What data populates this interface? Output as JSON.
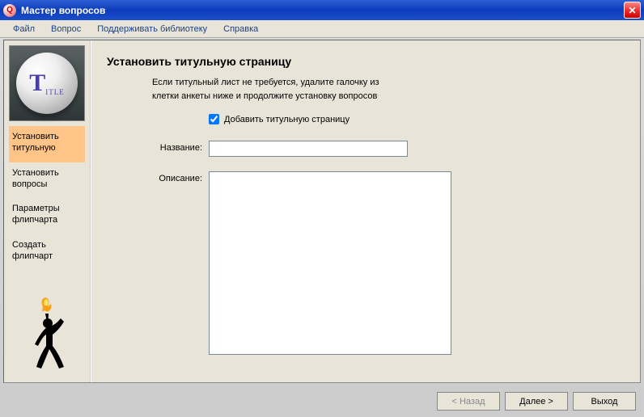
{
  "window": {
    "title": "Мастер вопросов"
  },
  "menu": {
    "file": "Файл",
    "question": "Вопрос",
    "maintain_library": "Поддерживать библиотеку",
    "help": "Справка"
  },
  "sidebar": {
    "items": [
      {
        "label": "Установить титульную",
        "selected": true
      },
      {
        "label": "Установить вопросы",
        "selected": false
      },
      {
        "label": "Параметры флипчарта",
        "selected": false
      },
      {
        "label": "Создать флипчарт",
        "selected": false
      }
    ]
  },
  "main": {
    "title": "Установить титульную страницу",
    "help_line1": "Если титульный лист не требуется, удалите галочку из",
    "help_line2": "клетки анкеты ниже и продолжите установку вопросов",
    "checkbox_label": "Добавить титульную страницу",
    "checkbox_checked": true,
    "name_label": "Название:",
    "name_value": "",
    "description_label": "Описание:",
    "description_value": ""
  },
  "buttons": {
    "back": "< Назад",
    "next": "Далее >",
    "exit": "Выход"
  }
}
